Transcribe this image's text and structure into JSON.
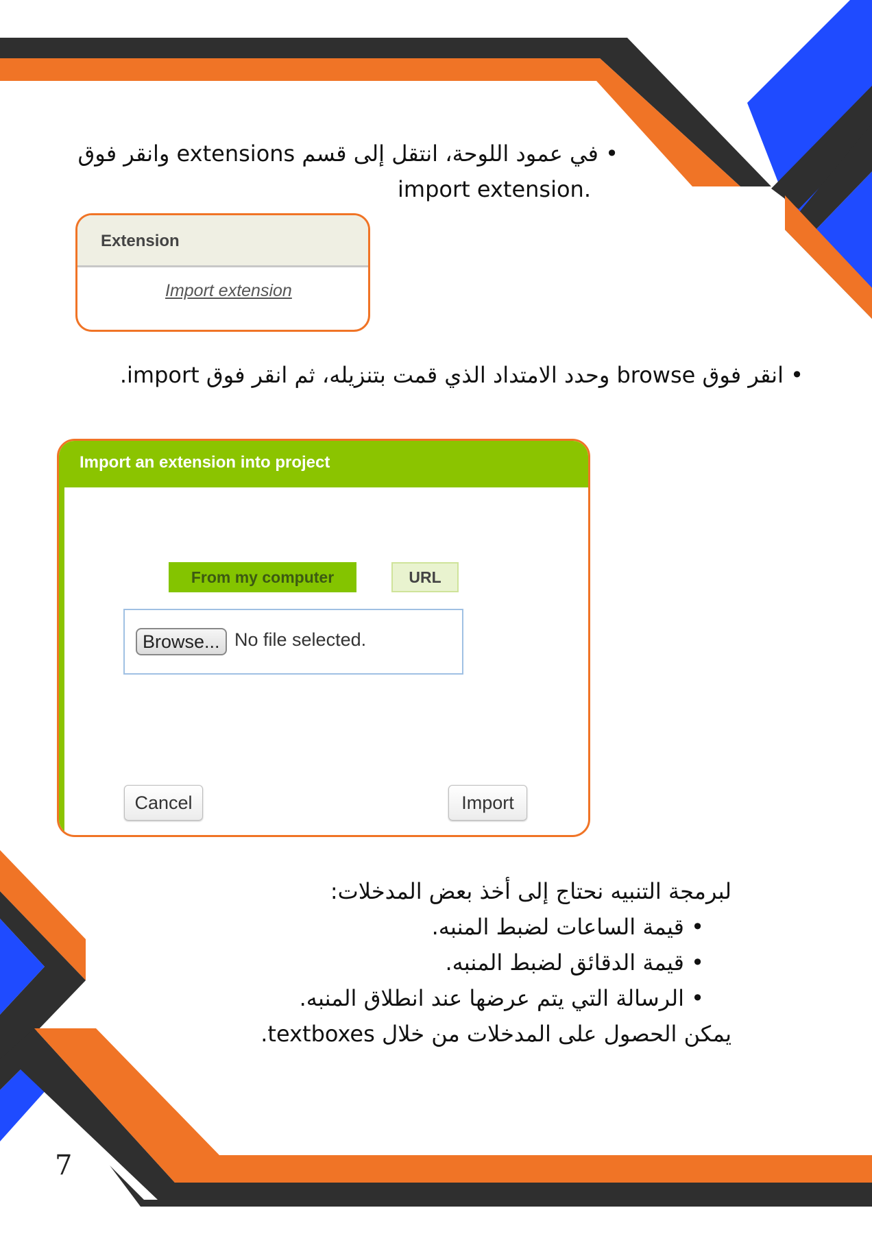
{
  "instructions": {
    "step1_line1": "في عمود اللوحة، انتقل إلى قسم extensions وانقر فوق",
    "step1_line2": ".import extension",
    "step2": "انقر فوق browse وحدد الامتداد الذي قمت بتنزيله، ثم انقر فوق import."
  },
  "extension_panel": {
    "header": "Extension",
    "link": "Import extension"
  },
  "import_dialog": {
    "title": "Import an extension into project",
    "tab_computer": "From my computer",
    "tab_url": "URL",
    "browse_button": "Browse...",
    "file_status": "No file selected.",
    "cancel_button": "Cancel",
    "import_button": "Import"
  },
  "inputs_section": {
    "intro": "لبرمجة التنبيه نحتاج إلى أخذ بعض المدخلات:",
    "items": [
      "قيمة الساعات لضبط المنبه.",
      "قيمة الدقائق لضبط المنبه.",
      "الرسالة التي يتم عرضها عند انطلاق المنبه."
    ],
    "outro": "يمكن الحصول على المدخلات من خلال textboxes."
  },
  "page_number": "7",
  "colors": {
    "orange": "#f07426",
    "dark": "#2f2f2f",
    "blue": "#1f4bff",
    "dialog_green": "#8bc400"
  }
}
